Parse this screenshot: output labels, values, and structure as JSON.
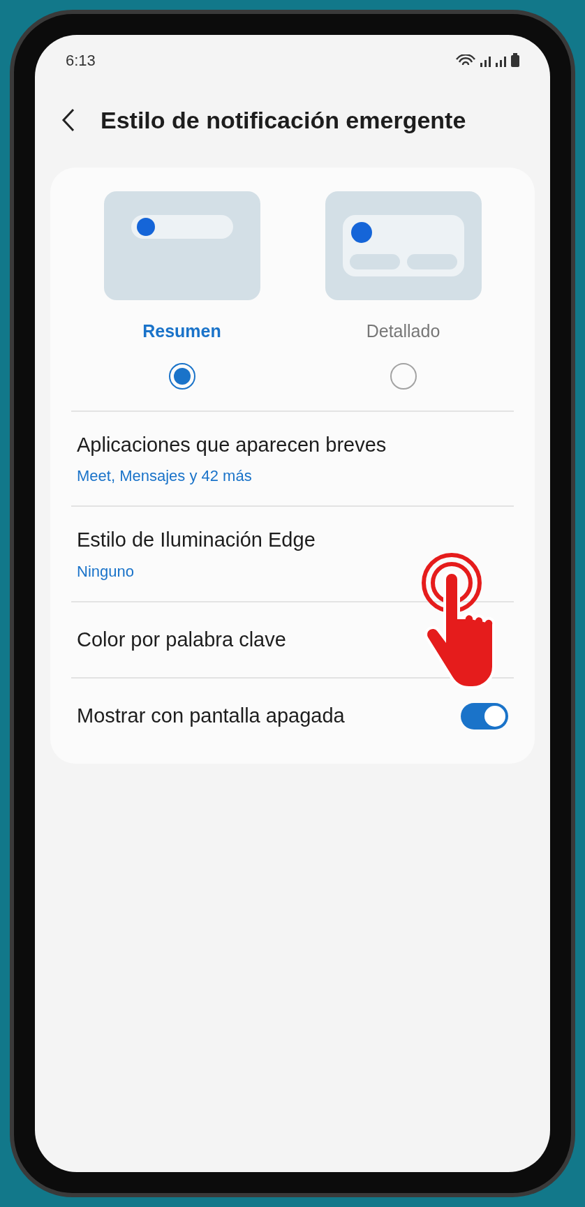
{
  "status_bar": {
    "time": "6:13"
  },
  "header": {
    "title": "Estilo de notificación emergente"
  },
  "styles": [
    {
      "label": "Resumen",
      "kind": "brief",
      "selected": true
    },
    {
      "label": "Detallado",
      "kind": "detailed",
      "selected": false
    }
  ],
  "settings": [
    {
      "kind": "link",
      "title": "Aplicaciones que aparecen breves",
      "value": "Meet, Mensajes y 42 más"
    },
    {
      "kind": "link",
      "title": "Estilo de Iluminación Edge",
      "value": "Ninguno"
    },
    {
      "kind": "link",
      "title": "Color por palabra clave"
    },
    {
      "kind": "toggle",
      "title": "Mostrar con pantalla apagada",
      "on": true
    }
  ]
}
